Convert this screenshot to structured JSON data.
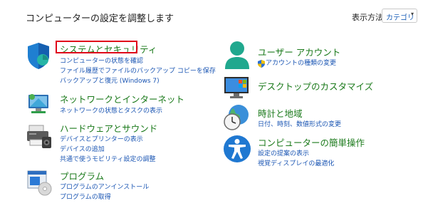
{
  "header": {
    "title": "コンピューターの設定を調整します",
    "view_by_label": "表示方法:",
    "view_by_value": "カテゴリ",
    "view_by_chevron": "▾"
  },
  "categories": {
    "security": {
      "title": "システムとセキュリティ",
      "links": [
        "コンピューターの状態を確認",
        "ファイル履歴でファイルのバックアップ コピーを保存",
        "バックアップと復元 (Windows 7)"
      ],
      "highlighted": true
    },
    "network": {
      "title": "ネットワークとインターネット",
      "links": [
        "ネットワークの状態とタスクの表示"
      ]
    },
    "hardware": {
      "title": "ハードウェアとサウンド",
      "links": [
        "デバイスとプリンターの表示",
        "デバイスの追加",
        "共通で使うモビリティ設定の調整"
      ]
    },
    "programs": {
      "title": "プログラム",
      "links": [
        "プログラムのアンインストール",
        "プログラムの取得"
      ]
    },
    "user_accounts": {
      "title": "ユーザー アカウント",
      "links": [
        "アカウントの種類の変更"
      ]
    },
    "appearance": {
      "title": "デスクトップのカスタマイズ",
      "links": []
    },
    "clock_region": {
      "title": "時計と地域",
      "links": [
        "日付、時刻、数値形式の変更"
      ]
    },
    "ease_of_access": {
      "title": "コンピューターの簡単操作",
      "links": [
        "設定の提案の表示",
        "視覚ディスプレイの最適化"
      ]
    }
  },
  "colors": {
    "title_green": "#1b7a1b",
    "link_blue": "#1a55b3",
    "highlight_red": "#e0001a"
  }
}
